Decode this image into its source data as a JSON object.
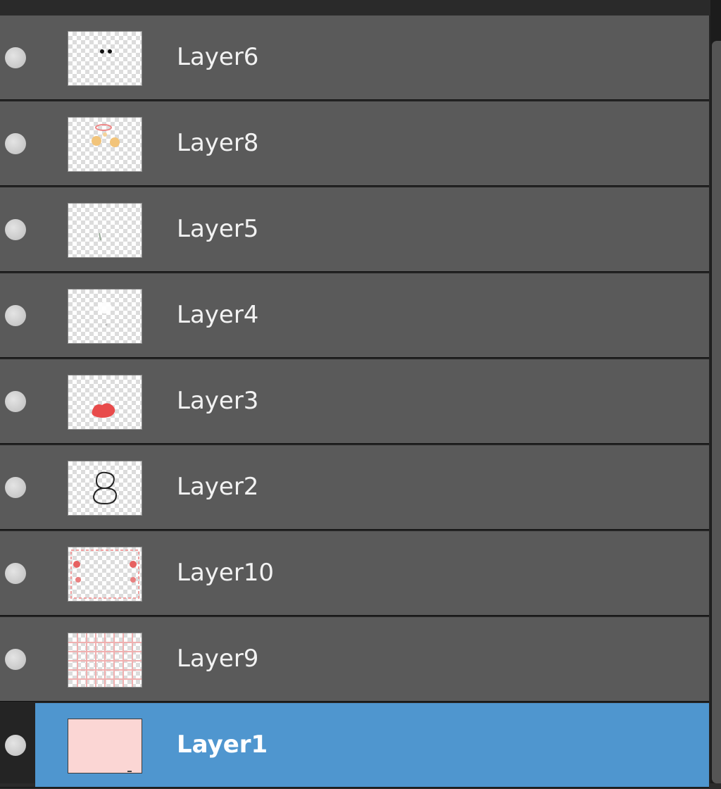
{
  "layers_panel": {
    "layers": [
      {
        "name": "Layer6",
        "visible": true,
        "selected": false,
        "thumbnail": "eyes"
      },
      {
        "name": "Layer8",
        "visible": true,
        "selected": false,
        "thumbnail": "cheeks"
      },
      {
        "name": "Layer5",
        "visible": true,
        "selected": false,
        "thumbnail": "mark"
      },
      {
        "name": "Layer4",
        "visible": true,
        "selected": false,
        "thumbnail": "highlight"
      },
      {
        "name": "Layer3",
        "visible": true,
        "selected": false,
        "thumbnail": "red-blob"
      },
      {
        "name": "Layer2",
        "visible": true,
        "selected": false,
        "thumbnail": "outline"
      },
      {
        "name": "Layer10",
        "visible": true,
        "selected": false,
        "thumbnail": "frame-dots"
      },
      {
        "name": "Layer9",
        "visible": true,
        "selected": false,
        "thumbnail": "pink-grid"
      },
      {
        "name": "Layer1",
        "visible": true,
        "selected": true,
        "thumbnail": "solid-fill"
      }
    ]
  },
  "colors": {
    "row_bg": "#5a5a5a",
    "selected_bg": "#4f96cf",
    "panel_bg": "#242424",
    "base_fill": "#fbd6d4"
  }
}
